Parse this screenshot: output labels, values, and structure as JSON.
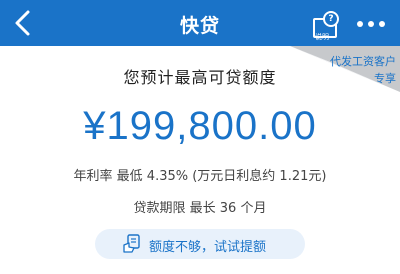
{
  "header": {
    "title": "快贷",
    "back_icon": "chevron-left-icon",
    "help": {
      "icon": "help-document-icon",
      "label": "说明",
      "badge": "?"
    },
    "more_icon": "more-dots-icon"
  },
  "corner_tag": {
    "line1": "代发工资客户",
    "line2": "专享"
  },
  "main": {
    "headline": "您预计最高可贷额度",
    "amount": "¥199,800.00",
    "rate_text": "年利率 最低 4.35% (万元日利息约 1.21元)",
    "term_text": "贷款期限 最长 36 个月"
  },
  "raise_limit": {
    "icon": "hand-document-icon",
    "label": "额度不够，试试提额"
  },
  "colors": {
    "brand_blue": "#1a73c8",
    "pill_background": "#e8f1fb",
    "corner_fold": "#c7c9cc"
  }
}
